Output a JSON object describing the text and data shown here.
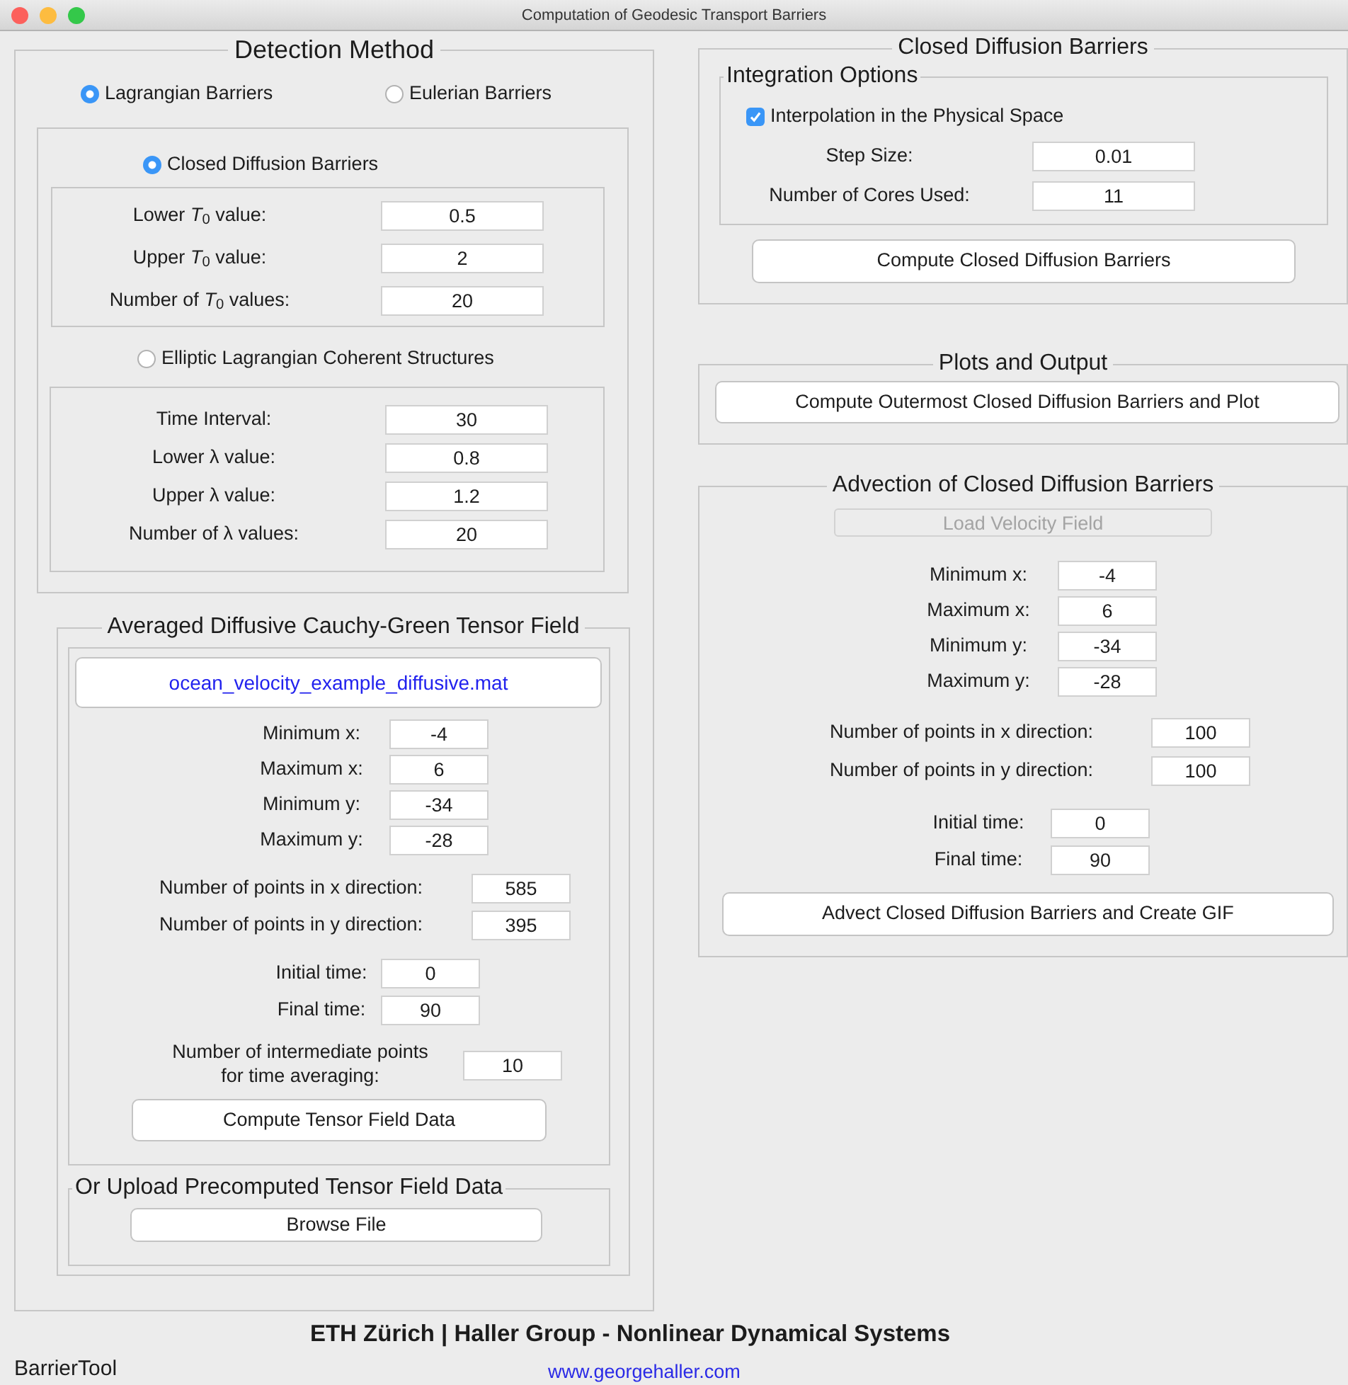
{
  "window": {
    "title": "Computation of Geodesic Transport Barriers"
  },
  "detection_method": {
    "title": "Detection Method",
    "barrier_types": [
      {
        "label": "Lagrangian Barriers",
        "selected": true
      },
      {
        "label": "Eulerian Barriers",
        "selected": false
      }
    ],
    "methods": [
      {
        "label": "Closed Diffusion Barriers",
        "selected": true,
        "fields": [
          {
            "label": "Lower *T*$_{0}$  value:",
            "value": "0.5"
          },
          {
            "label": "Upper *T*$_{0}$  value:",
            "value": "2"
          },
          {
            "label": "Number of  *T*$_{0}$  values:",
            "value": "20"
          }
        ]
      },
      {
        "label": "Elliptic Lagrangian Coherent Structures",
        "selected": false,
        "fields": [
          {
            "label": "Time Interval:",
            "value": "30"
          },
          {
            "label": "Lower  λ value:",
            "value": "0.8"
          },
          {
            "label": "Upper  λ  value:",
            "value": "1.2"
          },
          {
            "label": "Number of  λ  values:",
            "value": "20"
          }
        ]
      }
    ]
  },
  "tensor_field": {
    "title": "Averaged Diffusive Cauchy-Green Tensor Field",
    "file_button": "ocean_velocity_example_diffusive.mat",
    "field_groups": [
      [
        {
          "label": "Minimum x:",
          "value": "-4"
        },
        {
          "label": "Maximum x:",
          "value": "6"
        },
        {
          "label": "Minimum y:",
          "value": "-34"
        },
        {
          "label": "Maximum y:",
          "value": "-28"
        }
      ],
      [
        {
          "label": "Number of points in x direction:",
          "value": "585"
        },
        {
          "label": "Number of points in y direction:",
          "value": "395"
        }
      ],
      [
        {
          "label": "Initial time:",
          "value": "0"
        },
        {
          "label": "Final time:",
          "value": "90"
        }
      ],
      [
        {
          "label": "Number of intermediate points\nfor time averaging:",
          "value": "10"
        }
      ]
    ],
    "compute_button": "Compute Tensor Field Data",
    "upload": {
      "title": "Or Upload Precomputed Tensor Field Data",
      "button": "Browse File"
    }
  },
  "closed_diffusion_barriers": {
    "title": "Closed Diffusion Barriers",
    "integration_options": {
      "title": "Integration Options",
      "interpolation": {
        "label": "Interpolation in the Physical Space",
        "checked": true
      },
      "fields": [
        {
          "label": "Step Size:",
          "value": "0.01"
        },
        {
          "label": "Number of Cores Used:",
          "value": "11"
        }
      ]
    },
    "compute_button": "Compute Closed Diffusion Barriers"
  },
  "plots_and_output": {
    "title": "Plots and Output",
    "button": "Compute Outermost Closed Diffusion Barriers and Plot"
  },
  "advection": {
    "title": "Advection of Closed Diffusion Barriers",
    "load_button": {
      "label": "Load Velocity Field",
      "disabled": true
    },
    "field_groups": [
      [
        {
          "label": "Minimum x:",
          "value": "-4"
        },
        {
          "label": "Maximum x:",
          "value": "6"
        },
        {
          "label": "Minimum y:",
          "value": "-34"
        },
        {
          "label": "Maximum y:",
          "value": "-28"
        }
      ],
      [
        {
          "label": "Number of points in x direction:",
          "value": "100"
        },
        {
          "label": "Number of points in y direction:",
          "value": "100"
        }
      ],
      [
        {
          "label": "Initial time:",
          "value": "0"
        },
        {
          "label": "Final time:",
          "value": "90"
        }
      ]
    ],
    "button": "Advect Closed Diffusion Barriers and Create GIF"
  },
  "footer": {
    "credit": "ETH Zürich | Haller Group - Nonlinear Dynamical Systems",
    "app_name": "BarrierTool",
    "url": "www.georgehaller.com"
  }
}
